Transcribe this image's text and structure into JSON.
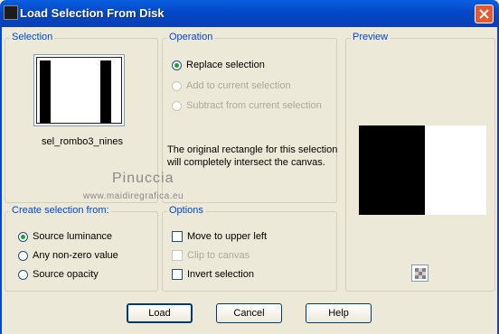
{
  "window": {
    "title": "Load Selection From Disk",
    "icon": "app-icon",
    "close_icon": "close-icon"
  },
  "selection": {
    "label": "Selection",
    "thumbnail_name": "sel_rombo3_nines"
  },
  "operation": {
    "label": "Operation",
    "options": [
      {
        "label": "Replace selection",
        "checked": true,
        "enabled": true
      },
      {
        "label": "Add to current selection",
        "checked": false,
        "enabled": false
      },
      {
        "label": "Subtract from current selection",
        "checked": false,
        "enabled": false
      }
    ],
    "description_line1": "The original rectangle for this selection",
    "description_line2": "will completely intersect the canvas."
  },
  "preview": {
    "label": "Preview",
    "icon": "checkerboard-icon"
  },
  "create_from": {
    "label": "Create selection from:",
    "options": [
      {
        "label": "Source luminance",
        "checked": true
      },
      {
        "label": "Any non-zero value",
        "checked": false
      },
      {
        "label": "Source opacity",
        "checked": false
      }
    ]
  },
  "options": {
    "label": "Options",
    "items": [
      {
        "label": "Move to upper left",
        "checked": false,
        "enabled": true
      },
      {
        "label": "Clip to canvas",
        "checked": false,
        "enabled": false
      },
      {
        "label": "Invert selection",
        "checked": false,
        "enabled": true
      }
    ]
  },
  "buttons": {
    "load": "Load",
    "cancel": "Cancel",
    "help": "Help"
  },
  "watermark": {
    "line1": "Pinuccia",
    "line2": "www.maidiregrafica.eu"
  },
  "colors": {
    "title_blue": "#0348c8",
    "group_label": "#0046d5",
    "close_red": "#e35a2e",
    "radio_dot": "#21a121"
  }
}
